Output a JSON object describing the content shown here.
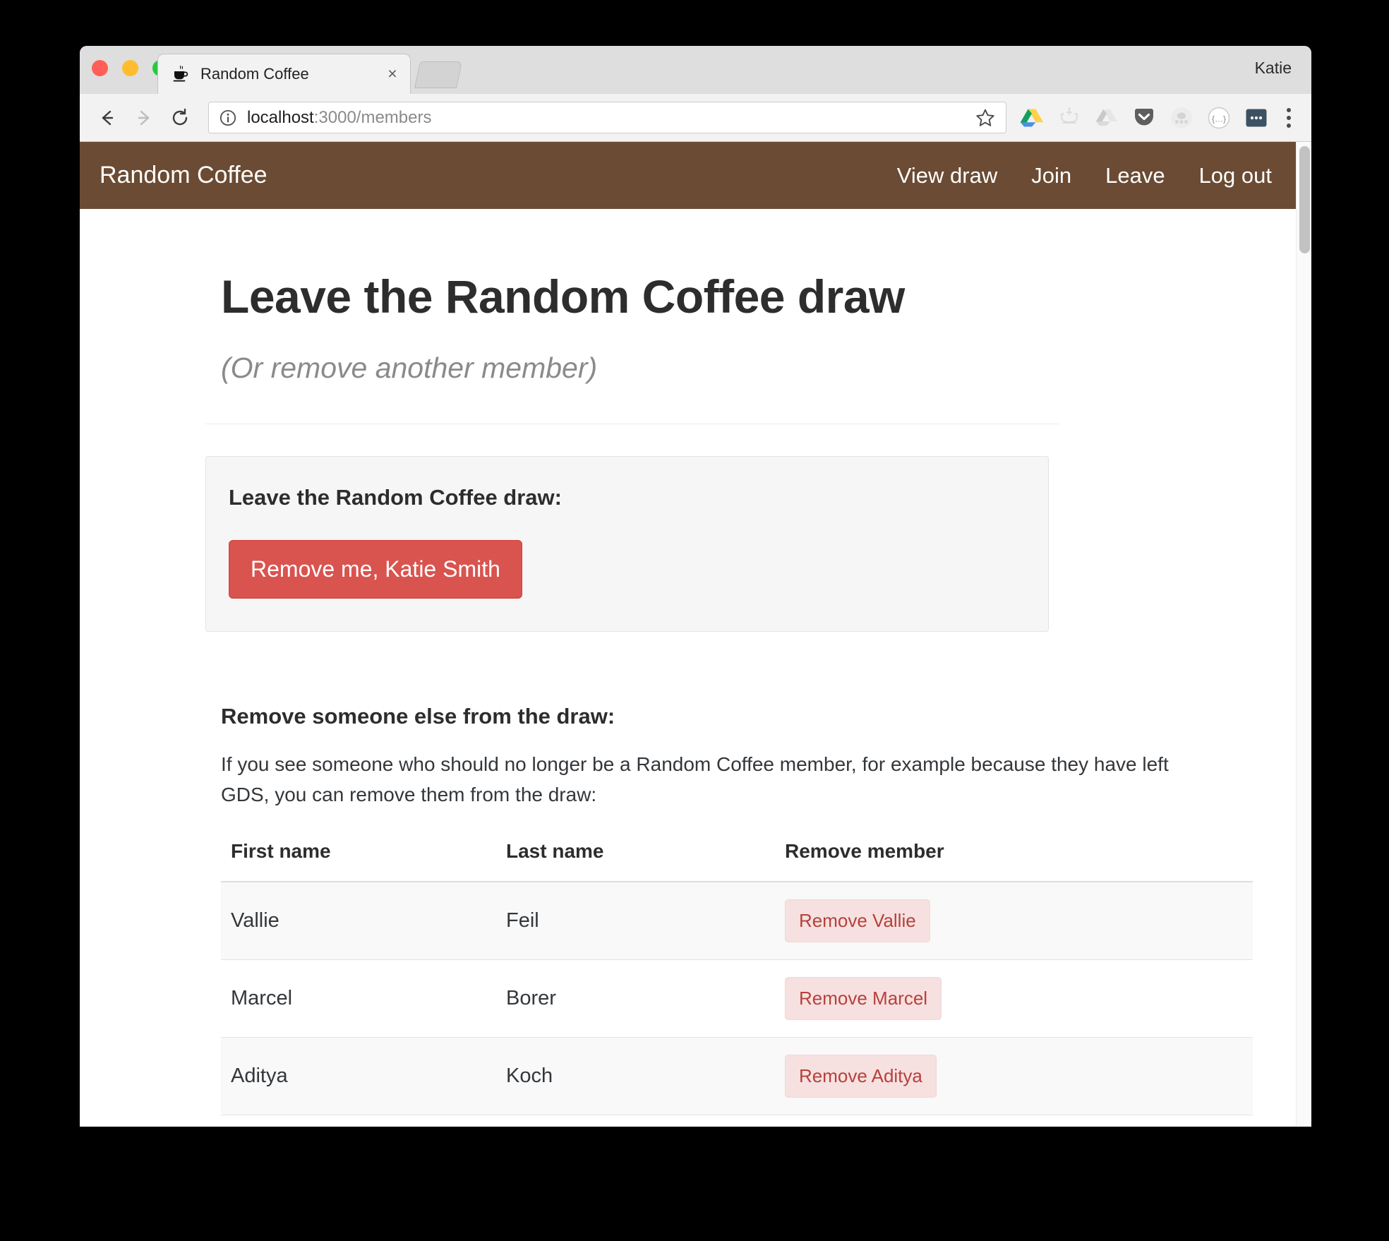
{
  "window": {
    "user_label": "Katie",
    "tab": {
      "favicon": "coffee-cup-icon",
      "title": "Random Coffee",
      "close_label": "×"
    },
    "new_tab_label": ""
  },
  "toolbar": {
    "back_icon": "back-arrow-icon",
    "forward_icon": "forward-arrow-icon",
    "reload_icon": "reload-icon",
    "info_icon": "info-circle-icon",
    "url_host": "localhost",
    "url_rest": ":3000/members",
    "star_icon": "bookmark-star-icon",
    "extensions": [
      "google-drive-icon",
      "crown-icon",
      "drive-grey-icon",
      "pocket-icon",
      "avatar-grey-icon",
      "json-braces-icon",
      "ellipsis-square-icon"
    ],
    "menu_icon": "three-dot-menu-icon"
  },
  "site": {
    "brand": "Random Coffee",
    "nav_links": [
      {
        "label": "View draw"
      },
      {
        "label": "Join"
      },
      {
        "label": "Leave"
      },
      {
        "label": "Log out"
      }
    ],
    "accent_color": "#6b4b33"
  },
  "main": {
    "title": "Leave the Random Coffee draw",
    "subtitle": "(Or remove another member)",
    "leave_panel": {
      "heading": "Leave the Random Coffee draw:",
      "button_label": "Remove me, Katie Smith",
      "button_color": "#d9534f"
    },
    "remove_others": {
      "heading": "Remove someone else from the draw:",
      "paragraph": "If you see someone who should no longer be a Random Coffee member, for example because they have left GDS, you can remove them from the draw:",
      "table": {
        "headers": [
          "First name",
          "Last name",
          "Remove member"
        ],
        "rows": [
          {
            "first_name": "Vallie",
            "last_name": "Feil",
            "action_label": "Remove Vallie"
          },
          {
            "first_name": "Marcel",
            "last_name": "Borer",
            "action_label": "Remove Marcel"
          },
          {
            "first_name": "Aditya",
            "last_name": "Koch",
            "action_label": "Remove Aditya"
          }
        ]
      }
    }
  }
}
